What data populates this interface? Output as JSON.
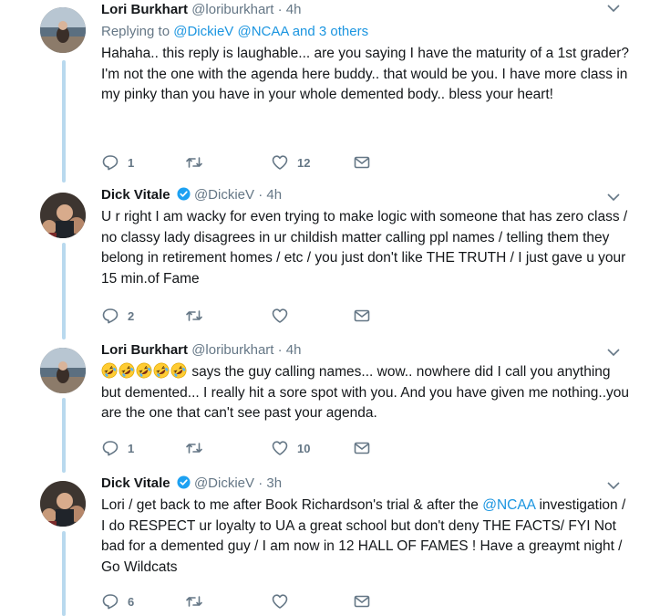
{
  "tweets": [
    {
      "name": "Lori Burkhart",
      "verified": false,
      "handle": "@loriburkhart",
      "dot": "·",
      "time": "4h",
      "replying_prefix": "Replying to",
      "replying_links": [
        "@DickieV",
        "@NCAA"
      ],
      "replying_suffix": "and 3 others",
      "text": "Hahaha.. this reply is laughable... are you saying I have the maturity of a 1st grader? I'm not the one with the agenda here buddy.. that would be you. I have more class in my pinky than you have in your whole demented body.. bless your heart!",
      "replies": "1",
      "retweets": "",
      "likes": "12"
    },
    {
      "name": "Dick Vitale",
      "verified": true,
      "handle": "@DickieV",
      "dot": "·",
      "time": "4h",
      "text": "U r right I am wacky for even trying to make logic with someone that has zero class  / no classy lady disagrees in ur childish matter calling ppl names / telling them they belong in retirement homes / etc / you just don't like THE TRUTH / I just gave u your 15 min.of Fame",
      "replies": "2",
      "retweets": "",
      "likes": ""
    },
    {
      "name": "Lori Burkhart",
      "verified": false,
      "handle": "@loriburkhart",
      "dot": "·",
      "time": "4h",
      "emoji_count": 5,
      "emoji_name": "rolling-on-floor-laughing",
      "text": "says the guy calling names... wow.. nowhere did I call you anything but demented... I really hit a sore spot with you. And you have given me nothing..you are the one that can't see past your agenda.",
      "replies": "1",
      "retweets": "",
      "likes": "10"
    },
    {
      "name": "Dick Vitale",
      "verified": true,
      "handle": "@DickieV",
      "dot": "·",
      "time": "3h",
      "text_before_mention": "Lori  / get back to me after Book Richardson's trial & after the",
      "mention": "@NCAA",
      "text_after_mention": "investigation / I do RESPECT ur loyalty to UA a great school but don't deny THE FACTS/ FYI Not bad for a demented guy / I am now in 12 HALL OF FAMES ! Have a greaymt night / Go Wildcats",
      "replies": "6",
      "retweets": "",
      "likes": ""
    }
  ],
  "icons": {
    "reply": "reply-icon",
    "retweet": "retweet-icon",
    "like": "heart-icon",
    "dm": "envelope-icon",
    "more": "chevron-down-icon",
    "verified": "verified-badge-icon"
  },
  "colors": {
    "accent": "#1b95e0",
    "thread_line": "#b9d9ee",
    "muted": "#657786",
    "text": "#14171a"
  }
}
